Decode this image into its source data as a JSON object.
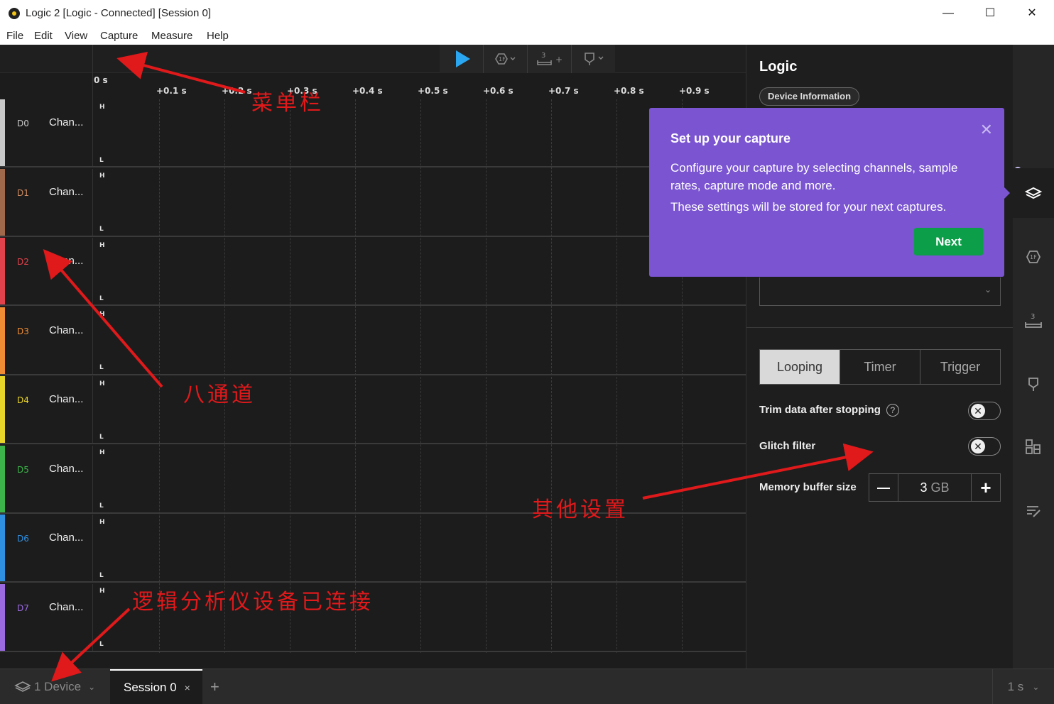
{
  "window": {
    "title": "Logic 2 [Logic - Connected] [Session 0]",
    "controls": [
      "—",
      "☐",
      "✕"
    ]
  },
  "menu": [
    "File",
    "Edit",
    "View",
    "Capture",
    "Measure",
    "Help"
  ],
  "toolbar": {
    "play_icon": "play-icon",
    "trigger_label": "1F",
    "timing_label": "3",
    "timing_add": "+"
  },
  "timeline": {
    "zero_label": "0 s",
    "ticks": [
      "+0.1 s",
      "+0.2 s",
      "+0.3 s",
      "+0.4 s",
      "+0.5 s",
      "+0.6 s",
      "+0.7 s",
      "+0.8 s",
      "+0.9 s"
    ]
  },
  "channels": [
    {
      "id": "D0",
      "name": "Chan...",
      "color": "#c8c8c8"
    },
    {
      "id": "D1",
      "name": "Chan...",
      "color": "#a0694c"
    },
    {
      "id": "D2",
      "name": "Chan...",
      "color": "#e2424c"
    },
    {
      "id": "D3",
      "name": "Chan...",
      "color": "#f08c33"
    },
    {
      "id": "D4",
      "name": "Chan...",
      "color": "#e8d52a"
    },
    {
      "id": "D5",
      "name": "Chan...",
      "color": "#3cb54a"
    },
    {
      "id": "D6",
      "name": "Chan...",
      "color": "#2f8fe0"
    },
    {
      "id": "D7",
      "name": "Chan...",
      "color": "#9b6ae0"
    }
  ],
  "high_label": "H",
  "low_label": "L",
  "panel": {
    "title": "Logic",
    "device_info": "Device Information",
    "mode_tabs": [
      "Looping",
      "Timer",
      "Trigger"
    ],
    "active_mode": "Looping",
    "trim_label": "Trim data after stopping",
    "help_icon": "?",
    "glitch_label": "Glitch filter",
    "memory_label": "Memory buffer size",
    "memory_value": "3",
    "memory_unit": "GB",
    "minus": "—",
    "plus": "+",
    "toggle_off": "✕"
  },
  "popover": {
    "title": "Set up your capture",
    "body1": "Configure your capture by selecting channels, sample rates, capture mode and more.",
    "body2": "These settings will be stored for your next captures.",
    "next_label": "Next",
    "close": "✕"
  },
  "bottombar": {
    "device_label": "1 Device",
    "session_label": "Session 0",
    "session_close": "×",
    "add_tab": "+",
    "zoom_label": "1 s"
  },
  "annotations": {
    "menu_bar": "菜单栏",
    "eight_channels": "八通道",
    "other_settings": "其他设置",
    "device_connected": "逻辑分析仪设备已连接"
  },
  "colors": {
    "accent_purple": "#7a54d1",
    "next_green": "#0d9e4a",
    "play_blue": "#2aa7f0",
    "annotation_red": "#e0191b"
  }
}
